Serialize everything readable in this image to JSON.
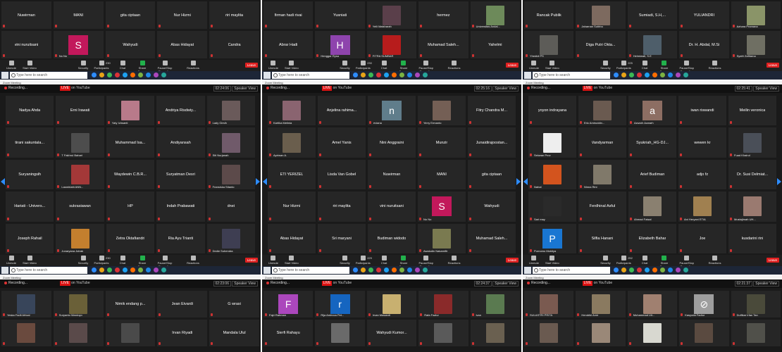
{
  "zoom_title": "Zoom Meeting",
  "recording": "Recording...",
  "live": "LIVE",
  "on_youtube": "on YouTube",
  "speaker_view": "Speaker View",
  "search_placeholder": "Type here to search",
  "toolbar": {
    "unmute": "Unmute",
    "start_video": "Start Video",
    "security": "Security",
    "participants": "Participants",
    "chat": "Chat",
    "share": "Share Screen",
    "pause": "Pause/Stop Recording",
    "reactions": "Reactions",
    "leave": "Leave"
  },
  "panels": [
    {
      "time": "",
      "participants": "230",
      "tiles": [
        {
          "name": "Nuwirman"
        },
        {
          "name": "MANI"
        },
        {
          "name": "gita ciptaan"
        },
        {
          "name": "Nur Hizmi"
        },
        {
          "name": "riri maylita"
        },
        {
          "name": "vini nuruitsani"
        },
        {
          "avatar": "S",
          "color": "#c2185b",
          "label": "No No"
        },
        {
          "name": "Wahyudi"
        },
        {
          "name": "Abas Hidayat"
        },
        {
          "name": "Candra"
        }
      ]
    },
    {
      "time": "",
      "participants": "230",
      "tiles": [
        {
          "name": "firman hadi rivai"
        },
        {
          "name": "Yusniati"
        },
        {
          "video": "#5a3f4a",
          "label": "Yelli Maisharah"
        },
        {
          "name": "hermez"
        },
        {
          "video": "#6d8a5a",
          "label": "Universitas Andal..."
        },
        {
          "name": "Abrar Hadi"
        },
        {
          "avatar": "H",
          "color": "#8e44ad",
          "label": "Henggar Rysa"
        },
        {
          "video": "#b71c1c",
          "label": "FITRA SUMBAR"
        },
        {
          "name": "Muhamad Saleh..."
        },
        {
          "name": "Yahelmi"
        }
      ]
    },
    {
      "time": "",
      "participants": "225",
      "tiles": [
        {
          "name": "Rancak Publik"
        },
        {
          "video": "#7d6a5f",
          "label": "Jaharnan Sutirbo"
        },
        {
          "name": "Sumiadi, S.H,..."
        },
        {
          "name": "YULIANDRI"
        },
        {
          "video": "#8a9468",
          "label": "Azhara Pramana"
        },
        {
          "video": "#5d5c58",
          "label": "Yhedidi PS"
        },
        {
          "name": "Diga Putri Okta..."
        },
        {
          "video": "#4e5e6a",
          "label": "Helmiwati, S.E"
        },
        {
          "name": "Dr. H. Abdal, M.Si"
        },
        {
          "video": "#6f6f63",
          "label": "Syafri Zaftlarna"
        }
      ]
    },
    {
      "time": "02:24:06",
      "participants": "230",
      "tiles": [
        {
          "name": "Nadya Ahda"
        },
        {
          "name": "Erni Irawati"
        },
        {
          "video": "#b87a8a",
          "label": "Yaty Ichsanti"
        },
        {
          "name": "Andriya  Risdwiy..."
        },
        {
          "video": "#6a5a5a",
          "label": "Lady Girsih"
        },
        {
          "name": "tirani sakuntala..."
        },
        {
          "video": "#4d4d4d",
          "label": "T Fakhrul Bahari"
        },
        {
          "name": "Muhammad  Isa..."
        },
        {
          "name": "Andiyansah"
        },
        {
          "video": "#705a6a",
          "label": "Siti Nurjanah"
        },
        {
          "name": "Suryaningsih"
        },
        {
          "video": "#a33838",
          "label": "Lasmiriatti ANN..."
        },
        {
          "name": "Waydewin  C.B.R..."
        },
        {
          "name": "Suryatman Desri"
        },
        {
          "video": "#5c4a4a",
          "label": "Fransiska Sitanto"
        },
        {
          "name": "Hariati - Univers..."
        },
        {
          "name": "sukrasiawan"
        },
        {
          "name": "HP"
        },
        {
          "name": "Indah Prabawati"
        },
        {
          "name": "dnei"
        },
        {
          "name": "Joseph Rahail"
        },
        {
          "video": "#c37f2e",
          "label": "Junaryana Jotrak"
        },
        {
          "name": "Zetra Oktafiandri"
        },
        {
          "name": "Ria Ayu Trianti"
        },
        {
          "video": "#3e3e52",
          "label": "Dedie Suhendra"
        }
      ]
    },
    {
      "time": "02:25:16",
      "participants": "229",
      "tiles": [
        {
          "video": "#8a6470",
          "label": "Kartika Melinia"
        },
        {
          "name": "Anjelina  rahima..."
        },
        {
          "avatar": "n",
          "color": "#607d8b",
          "label": "eviana"
        },
        {
          "video": "#745f55",
          "label": "Yerry Ermanto"
        },
        {
          "name": "Fitry Chandra M..."
        },
        {
          "video": "#6a5e4d",
          "label": "Apriwan A."
        },
        {
          "name": "Amel Yanis"
        },
        {
          "name": "Nini Anggraini"
        },
        {
          "name": "Munzir"
        },
        {
          "name": "Junaidirajoostan..."
        },
        {
          "name": "ETI YERIZEL"
        },
        {
          "name": "Lisda Van Gobel"
        },
        {
          "name": "Nuwirman"
        },
        {
          "name": "MANI"
        },
        {
          "name": "gita ciptaan"
        },
        {
          "name": "Nur Hizmi"
        },
        {
          "name": "riri maylita"
        },
        {
          "name": "vini nuruitsani"
        },
        {
          "avatar": "S",
          "color": "#c2185b",
          "label": "No No"
        },
        {
          "name": "Wahyudi"
        },
        {
          "name": "Abas Hidayat"
        },
        {
          "name": "Sri maryani"
        },
        {
          "name": "Budiman widodo"
        },
        {
          "video": "#7a7a50",
          "label": "Awaludin Nakarnifir"
        },
        {
          "name": "Muhamad  Saleh..."
        }
      ]
    },
    {
      "time": "02:25:41",
      "participants": "252",
      "tiles": [
        {
          "name": "yoyon indrayana"
        },
        {
          "video": "#6a5a50",
          "label": "Eric Amiruddin..."
        },
        {
          "avatar": "a",
          "color": "#8d6e63",
          "label": "Azwarh Azwarh"
        },
        {
          "name": "iwan riswandi"
        },
        {
          "name": "Meilin veronica"
        },
        {
          "video": "#eeeeee",
          "label": "Sekwan Prov"
        },
        {
          "name": "Vandyarman"
        },
        {
          "name": "Syukriah_HG-DJ..."
        },
        {
          "name": "wewen kr"
        },
        {
          "video": "#4a4f58",
          "label": "Fuad Khairul"
        },
        {
          "video": "#d3541e",
          "label": "Nahal"
        },
        {
          "video": "#80796a",
          "label": "Ninna Rini"
        },
        {
          "name": "Arief Budiman"
        },
        {
          "name": "adjo fz"
        },
        {
          "name": "Dr. Susi Delmiat..."
        },
        {
          "video": "#2a2a2a",
          "label": "Sari may"
        },
        {
          "name": "Ferdhinal Asful"
        },
        {
          "video": "#8a8070",
          "label": "Ahmad Faisal"
        },
        {
          "video": "#a08050",
          "label": "Ani Heryani ETIA"
        },
        {
          "video": "#9a7a70",
          "label": "Mustajimah UH..."
        },
        {
          "avatar": "P",
          "color": "#1976d2",
          "label": "Purnomo Moktiya"
        },
        {
          "name": "Silfia Hanani"
        },
        {
          "name": "Elizabeth Bahar"
        },
        {
          "name": "Joe"
        },
        {
          "name": "kusdarini rini"
        }
      ]
    },
    {
      "time": "02:23:06",
      "participants": "",
      "tiles": [
        {
          "video": "#38455a",
          "label": "Yeska Fadli Afrizal"
        },
        {
          "video": "#6a6038",
          "label": "Suryanto Wardoyo"
        },
        {
          "name": "Nimik endang p..."
        },
        {
          "name": "Jean Eivardi"
        },
        {
          "name": "G wrasi"
        },
        {
          "video": "#6a4a3e",
          "label": ""
        },
        {
          "video": "#5a4a4a",
          "label": ""
        },
        {
          "video": "#4a4a4a",
          "label": ""
        },
        {
          "name": "Irvan Riyadi"
        },
        {
          "name": "Mandala Ulul"
        }
      ]
    },
    {
      "time": "02:24:37",
      "participants": "",
      "tiles": [
        {
          "avatar": "F",
          "color": "#ab47bc",
          "label": "Fajri Rahman"
        },
        {
          "avatar": "r",
          "color": "#1565c0",
          "label": "Rija Ardecca Pet..."
        },
        {
          "video": "#c8b070",
          "label": "Irvan Mawardi"
        },
        {
          "video": "#8a2a2a",
          "label": "Rafa Fazlur"
        },
        {
          "video": "#5a7a50",
          "label": "ivan"
        },
        {
          "name": "Sierfi Rahayu"
        },
        {
          "video": "#6a6a6a",
          "label": ""
        },
        {
          "name": "Wahyudi  Kumor..."
        },
        {
          "video": "#5a5a5a",
          "label": ""
        },
        {
          "video": "#6a6050",
          "label": ""
        }
      ]
    },
    {
      "time": "02:21:37",
      "participants": "",
      "tiles": [
        {
          "video": "#7a5a50",
          "label": "SULASTRI PRITA"
        },
        {
          "video": "#8a7a60",
          "label": "Hendriki Amir"
        },
        {
          "video": "#a08070",
          "label": "Muhammad Uit..."
        },
        {
          "avatar": "⊘",
          "color": "#9e9e9e",
          "label": "Kasyoda Fadiur"
        },
        {
          "video": "#4a4a3a",
          "label": "Dulfikar Irfan Tan"
        },
        {
          "video": "#6a5a50",
          "label": ""
        },
        {
          "video": "#9a8878",
          "label": ""
        },
        {
          "video": "#d8d8d0",
          "label": ""
        },
        {
          "video": "#5a4a40",
          "label": ""
        },
        {
          "video": "#50504a",
          "label": ""
        }
      ]
    }
  ]
}
